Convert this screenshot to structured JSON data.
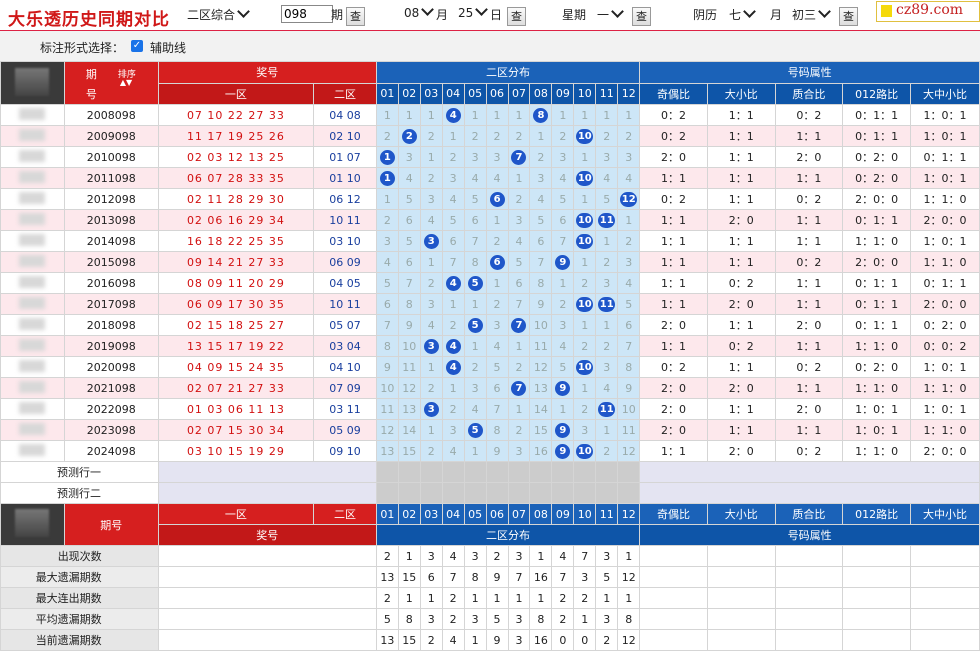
{
  "header": {
    "title": "大乐透历史同期对比",
    "zone_select": "二区综合",
    "issue_value": "098",
    "issue_unit": "期",
    "month_value": "08",
    "month_unit": "月",
    "day_value": "25",
    "day_unit": "日",
    "week_label": "星期",
    "week_value": "一",
    "lunar_label": "阴历",
    "lunar_month": "七",
    "lunar_month_unit": "月",
    "lunar_day": "初三",
    "query_label": "查",
    "logo_text": "cz89.com",
    "logo_color": "#f5d90a"
  },
  "options": {
    "label": "标注形式选择：",
    "checkbox_label": "辅助线",
    "checked": true
  },
  "table": {
    "col_issue_top": "期",
    "col_issue_bottom": "号",
    "sort_label": "排序",
    "prize_header": "奖号",
    "zone1": "一区",
    "zone2": "二区",
    "dist_header": "二区分布",
    "attr_header": "号码属性",
    "dist_cols": [
      "01",
      "02",
      "03",
      "04",
      "05",
      "06",
      "07",
      "08",
      "09",
      "10",
      "11",
      "12"
    ],
    "attr_cols": [
      "奇偶比",
      "大小比",
      "质合比",
      "012路比",
      "大中小比"
    ],
    "rows": [
      {
        "issue": "2008098",
        "z1": "07 10 22 27 33",
        "z2": "04 08",
        "dist": [
          1,
          1,
          1,
          "04",
          1,
          1,
          1,
          "08",
          1,
          1,
          1,
          1
        ],
        "attr": [
          "0：2",
          "1：1",
          "0：2",
          "0：1：1",
          "1：0：1"
        ]
      },
      {
        "issue": "2009098",
        "z1": "11 17 19 25 26",
        "z2": "02 10",
        "dist": [
          2,
          "02",
          2,
          1,
          2,
          2,
          2,
          1,
          2,
          "10",
          2,
          2
        ],
        "attr": [
          "0：2",
          "1：1",
          "1：1",
          "0：1：1",
          "1：0：1"
        ]
      },
      {
        "issue": "2010098",
        "z1": "02 03 12 13 25",
        "z2": "01 07",
        "dist": [
          "01",
          3,
          1,
          2,
          3,
          3,
          "07",
          2,
          3,
          1,
          3,
          3
        ],
        "attr": [
          "2：0",
          "1：1",
          "2：0",
          "0：2：0",
          "0：1：1"
        ]
      },
      {
        "issue": "2011098",
        "z1": "06 07 28 33 35",
        "z2": "01 10",
        "dist": [
          "01",
          4,
          2,
          3,
          4,
          4,
          1,
          3,
          4,
          "10",
          4,
          4
        ],
        "attr": [
          "1：1",
          "1：1",
          "1：1",
          "0：2：0",
          "1：0：1"
        ]
      },
      {
        "issue": "2012098",
        "z1": "02 11 28 29 30",
        "z2": "06 12",
        "dist": [
          1,
          5,
          3,
          4,
          5,
          "06",
          2,
          4,
          5,
          1,
          5,
          "12"
        ],
        "attr": [
          "0：2",
          "1：1",
          "0：2",
          "2：0：0",
          "1：1：0"
        ]
      },
      {
        "issue": "2013098",
        "z1": "02 06 16 29 34",
        "z2": "10 11",
        "dist": [
          2,
          6,
          4,
          5,
          6,
          1,
          3,
          5,
          6,
          "10",
          "11",
          1
        ],
        "attr": [
          "1：1",
          "2：0",
          "1：1",
          "0：1：1",
          "2：0：0"
        ]
      },
      {
        "issue": "2014098",
        "z1": "16 18 22 25 35",
        "z2": "03 10",
        "dist": [
          3,
          5,
          "03",
          6,
          7,
          2,
          4,
          6,
          7,
          "10",
          1,
          2
        ],
        "attr": [
          "1：1",
          "1：1",
          "1：1",
          "1：1：0",
          "1：0：1"
        ]
      },
      {
        "issue": "2015098",
        "z1": "09 14 21 27 33",
        "z2": "06 09",
        "dist": [
          4,
          6,
          1,
          7,
          8,
          "06",
          5,
          7,
          "09",
          1,
          2,
          3
        ],
        "attr": [
          "1：1",
          "1：1",
          "0：2",
          "2：0：0",
          "1：1：0"
        ]
      },
      {
        "issue": "2016098",
        "z1": "08 09 11 20 29",
        "z2": "04 05",
        "dist": [
          5,
          7,
          2,
          "04",
          "05",
          1,
          6,
          8,
          1,
          2,
          3,
          4
        ],
        "attr": [
          "1：1",
          "0：2",
          "1：1",
          "0：1：1",
          "0：1：1"
        ]
      },
      {
        "issue": "2017098",
        "z1": "06 09 17 30 35",
        "z2": "10 11",
        "dist": [
          6,
          8,
          3,
          1,
          1,
          2,
          7,
          9,
          2,
          "10",
          "11",
          5
        ],
        "attr": [
          "1：1",
          "2：0",
          "1：1",
          "0：1：1",
          "2：0：0"
        ]
      },
      {
        "issue": "2018098",
        "z1": "02 15 18 25 27",
        "z2": "05 07",
        "dist": [
          7,
          9,
          4,
          2,
          "05",
          3,
          "07",
          10,
          3,
          1,
          1,
          6
        ],
        "attr": [
          "2：0",
          "1：1",
          "2：0",
          "0：1：1",
          "0：2：0"
        ]
      },
      {
        "issue": "2019098",
        "z1": "13 15 17 19 22",
        "z2": "03 04",
        "dist": [
          8,
          10,
          "03",
          "04",
          1,
          4,
          1,
          11,
          4,
          2,
          2,
          7
        ],
        "attr": [
          "1：1",
          "0：2",
          "1：1",
          "1：1：0",
          "0：0：2"
        ]
      },
      {
        "issue": "2020098",
        "z1": "04 09 15 24 35",
        "z2": "04 10",
        "dist": [
          9,
          11,
          1,
          "04",
          2,
          5,
          2,
          12,
          5,
          "10",
          3,
          8
        ],
        "attr": [
          "0：2",
          "1：1",
          "0：2",
          "0：2：0",
          "1：0：1"
        ]
      },
      {
        "issue": "2021098",
        "z1": "02 07 21 27 33",
        "z2": "07 09",
        "dist": [
          10,
          12,
          2,
          1,
          3,
          6,
          "07",
          13,
          "09",
          1,
          4,
          9
        ],
        "attr": [
          "2：0",
          "2：0",
          "1：1",
          "1：1：0",
          "1：1：0"
        ]
      },
      {
        "issue": "2022098",
        "z1": "01 03 06 11 13",
        "z2": "03 11",
        "dist": [
          11,
          13,
          "03",
          2,
          4,
          7,
          1,
          14,
          1,
          2,
          "11",
          10
        ],
        "attr": [
          "2：0",
          "1：1",
          "2：0",
          "1：0：1",
          "1：0：1"
        ]
      },
      {
        "issue": "2023098",
        "z1": "02 07 15 30 34",
        "z2": "05 09",
        "dist": [
          12,
          14,
          1,
          3,
          "05",
          8,
          2,
          15,
          "09",
          3,
          1,
          11
        ],
        "attr": [
          "2：0",
          "1：1",
          "1：1",
          "1：0：1",
          "1：1：0"
        ]
      },
      {
        "issue": "2024098",
        "z1": "03 10 15 19 29",
        "z2": "09 10",
        "dist": [
          13,
          15,
          2,
          4,
          1,
          9,
          3,
          16,
          "09",
          "10",
          2,
          12
        ],
        "attr": [
          "1：1",
          "2：0",
          "0：2",
          "1：1：0",
          "2：0：0"
        ]
      }
    ],
    "predict1": "预测行一",
    "predict2": "预测行二",
    "footer_issue": "期号",
    "footer_prize": "奖号",
    "stats": [
      {
        "label": "出现次数",
        "values": [
          2,
          1,
          3,
          4,
          3,
          2,
          3,
          1,
          4,
          7,
          3,
          1
        ]
      },
      {
        "label": "最大遗漏期数",
        "values": [
          13,
          15,
          6,
          7,
          8,
          9,
          7,
          16,
          7,
          3,
          5,
          12
        ]
      },
      {
        "label": "最大连出期数",
        "values": [
          2,
          1,
          1,
          2,
          1,
          1,
          1,
          1,
          2,
          2,
          1,
          1
        ]
      },
      {
        "label": "平均遗漏期数",
        "values": [
          5,
          8,
          3,
          2,
          3,
          5,
          3,
          8,
          2,
          1,
          3,
          8
        ]
      },
      {
        "label": "当前遗漏期数",
        "values": [
          13,
          15,
          2,
          4,
          1,
          9,
          3,
          16,
          0,
          0,
          2,
          12
        ]
      }
    ]
  }
}
